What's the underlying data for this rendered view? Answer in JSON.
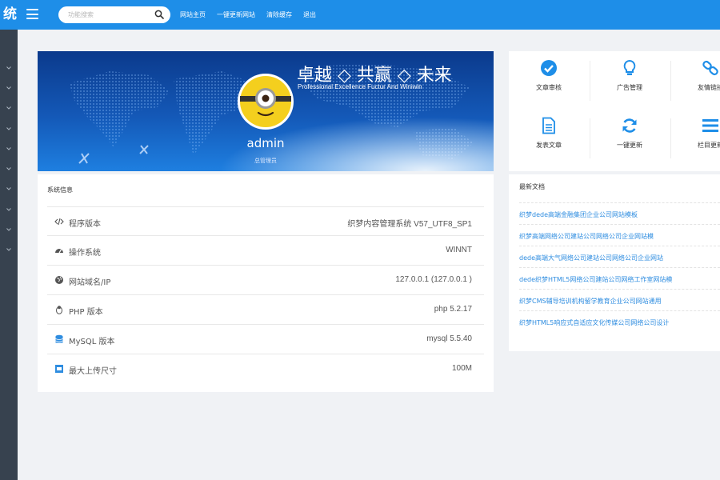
{
  "app": {
    "title_fragment": "统"
  },
  "header": {
    "search_placeholder": "功能搜索",
    "links": [
      "网站主页",
      "一键更新网站",
      "清除缓存",
      "退出"
    ]
  },
  "profile": {
    "username": "admin",
    "role": "总管理员",
    "slogan": "卓越 ◇ 共赢 ◇ 未来",
    "slogan_en": "Professional Excellence Fuctur And Winiwin"
  },
  "quick_actions": {
    "items": [
      {
        "label": "文章审核",
        "icon": "check-circle-icon"
      },
      {
        "label": "广告管理",
        "icon": "lightbulb-icon"
      },
      {
        "label": "友情链接",
        "icon": "link-icon"
      },
      {
        "label": "发表文章",
        "icon": "document-icon"
      },
      {
        "label": "一键更新",
        "icon": "refresh-icon"
      },
      {
        "label": "栏目更新",
        "icon": "list-icon"
      }
    ],
    "accent": "#1e8ee8"
  },
  "system_info": {
    "title": "系统信息",
    "rows": [
      {
        "icon": "code-icon",
        "label": "程序版本",
        "value": "织梦内容管理系统 V57_UTF8_SP1"
      },
      {
        "icon": "dashboard-icon",
        "label": "操作系统",
        "value": "WINNT"
      },
      {
        "icon": "globe-icon",
        "label": "网站域名/IP",
        "value": "127.0.0.1 (127.0.0.1 )"
      },
      {
        "icon": "linux-icon",
        "label": "PHP 版本",
        "value": "php 5.2.17"
      },
      {
        "icon": "database-icon",
        "label": "MySQL 版本",
        "value": "mysql 5.5.40"
      },
      {
        "icon": "upload-icon",
        "label": "最大上传尺寸",
        "value": "100M"
      }
    ]
  },
  "latest_docs": {
    "title": "最新文档",
    "items": [
      "织梦dede高端金融集团企业公司网站模板",
      "织梦高端网络公司建站公司网络公司企业网站模",
      "dede高端大气网络公司建站公司网络公司企业网站",
      "dede织梦HTML5网络公司建站公司网络工作室网站模",
      "织梦CMS辅导培训机构留学教育企业公司网站通用",
      "织梦HTML5响应式自适应文化传媒公司网络公司设计"
    ]
  },
  "colors": {
    "topbar": "#1e8ee8",
    "sidebar": "#37424f",
    "link": "#2f8de0"
  }
}
